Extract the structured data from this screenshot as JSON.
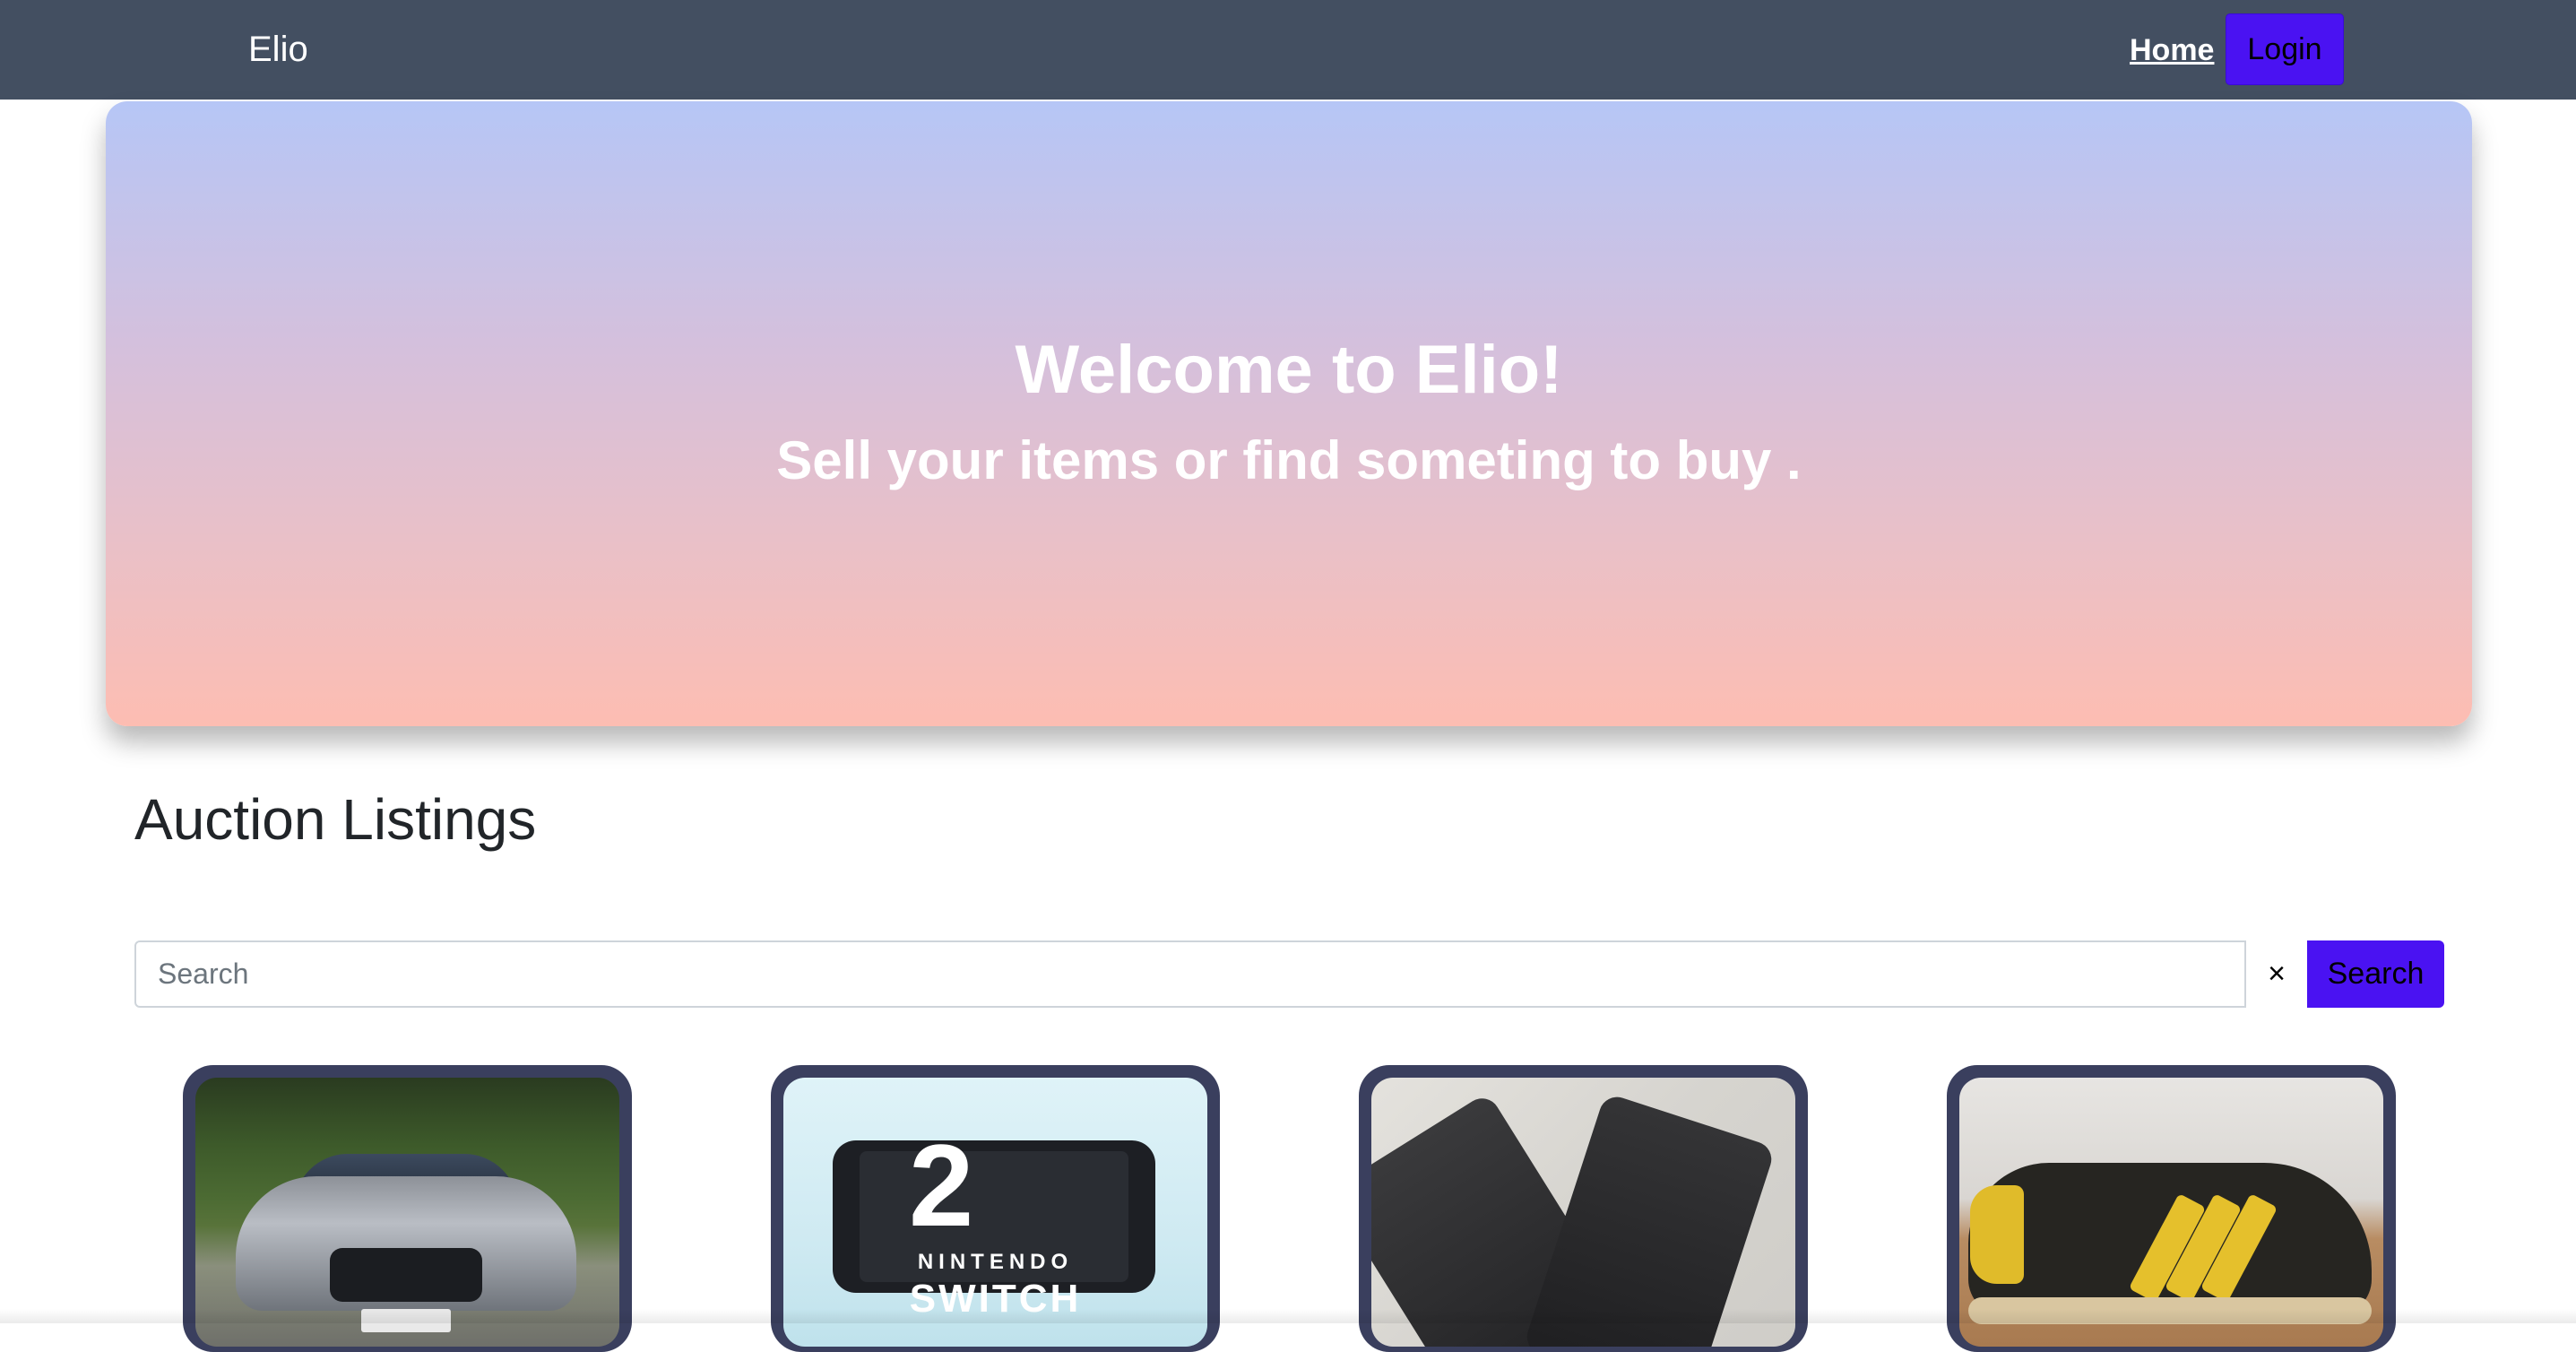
{
  "navbar": {
    "brand": "Elio",
    "home_label": "Home",
    "login_label": "Login"
  },
  "hero": {
    "title": "Welcome to Elio!",
    "subtitle": "Sell your items or find someting to buy ."
  },
  "listings": {
    "title": "Auction Listings",
    "search_placeholder": "Search",
    "search_value": "",
    "clear_label": "×",
    "search_button_label": "Search",
    "cards": [
      {
        "image": "car"
      },
      {
        "image": "nintendo-switch-2"
      },
      {
        "image": "jeans"
      },
      {
        "image": "sneakers"
      }
    ],
    "card_images": {
      "switch_logo": "2",
      "switch_brand_line1": "NINTENDO",
      "switch_brand_line2": "SWITCH"
    }
  },
  "colors": {
    "navbar": "#434f61",
    "accent": "#4a12f2",
    "card_frame": "#3a3f5e",
    "hero_top": "#b6c6f6",
    "hero_bottom": "#fdbdb2"
  }
}
